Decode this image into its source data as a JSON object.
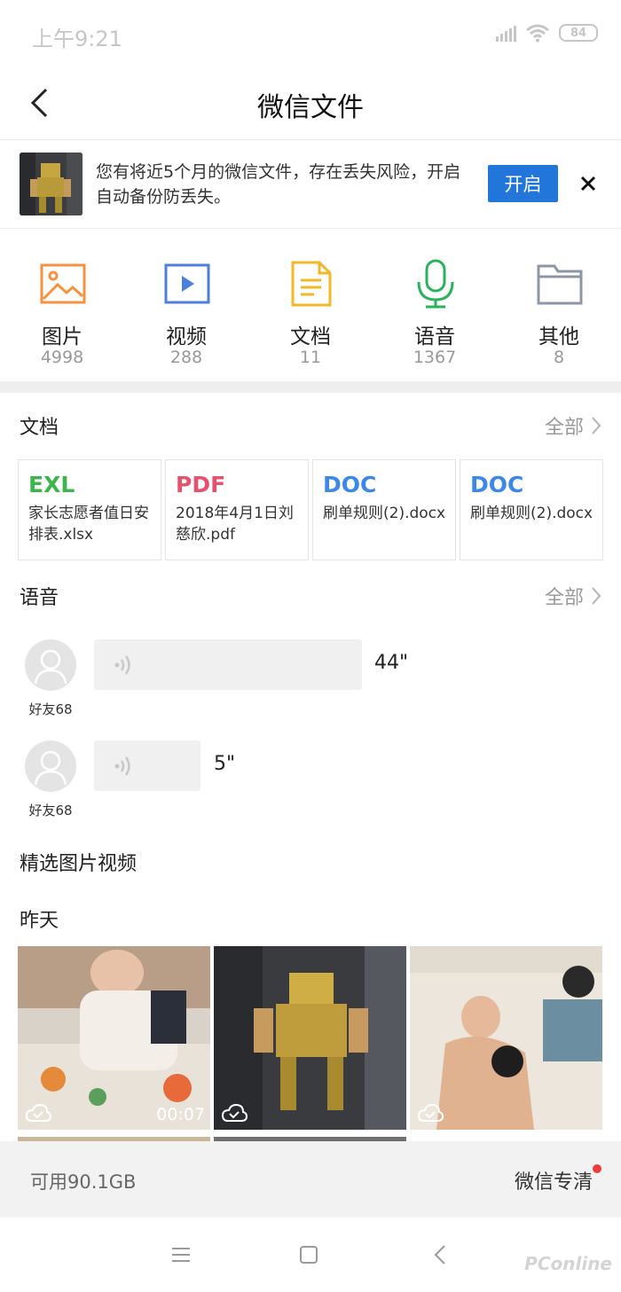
{
  "status_bar": {
    "time": "上午9:21",
    "battery": "84"
  },
  "nav": {
    "title": "微信文件"
  },
  "banner": {
    "text": "您有将近5个月的微信文件，存在丢失风险，开启自动备份防丢失。",
    "open_label": "开启"
  },
  "categories": [
    {
      "label": "图片",
      "count": "4998",
      "icon": "image-icon",
      "color": "#f4923e"
    },
    {
      "label": "视频",
      "count": "288",
      "icon": "video-icon",
      "color": "#4a7fe0"
    },
    {
      "label": "文档",
      "count": "11",
      "icon": "document-icon",
      "color": "#f2b827"
    },
    {
      "label": "语音",
      "count": "1367",
      "icon": "microphone-icon",
      "color": "#29b35a"
    },
    {
      "label": "其他",
      "count": "8",
      "icon": "folder-icon",
      "color": "#8c96a5"
    }
  ],
  "docs_section": {
    "title": "文档",
    "more_label": "全部",
    "items": [
      {
        "type": "EXL",
        "type_color": "#3cb64a",
        "name": "家长志愿者值日安排表.xlsx"
      },
      {
        "type": "PDF",
        "type_color": "#e8516b",
        "name": "2018年4月1日刘慈欣.pdf"
      },
      {
        "type": "DOC",
        "type_color": "#3c88e8",
        "name": "刷单规则(2).docx"
      },
      {
        "type": "DOC",
        "type_color": "#3c88e8",
        "name": "刷单规则(2).docx"
      }
    ]
  },
  "voice_section": {
    "title": "语音",
    "more_label": "全部",
    "items": [
      {
        "name": "好友68",
        "duration": "44\""
      },
      {
        "name": "好友68",
        "duration": "5\""
      }
    ]
  },
  "featured": {
    "title": "精选图片视频"
  },
  "gallery": {
    "date_label": "昨天",
    "items": [
      {
        "kind": "video",
        "duration": "00:07"
      },
      {
        "kind": "image"
      },
      {
        "kind": "image"
      }
    ]
  },
  "storage": {
    "available": "可用90.1GB",
    "clean_label": "微信专清"
  },
  "watermark": "PConline"
}
